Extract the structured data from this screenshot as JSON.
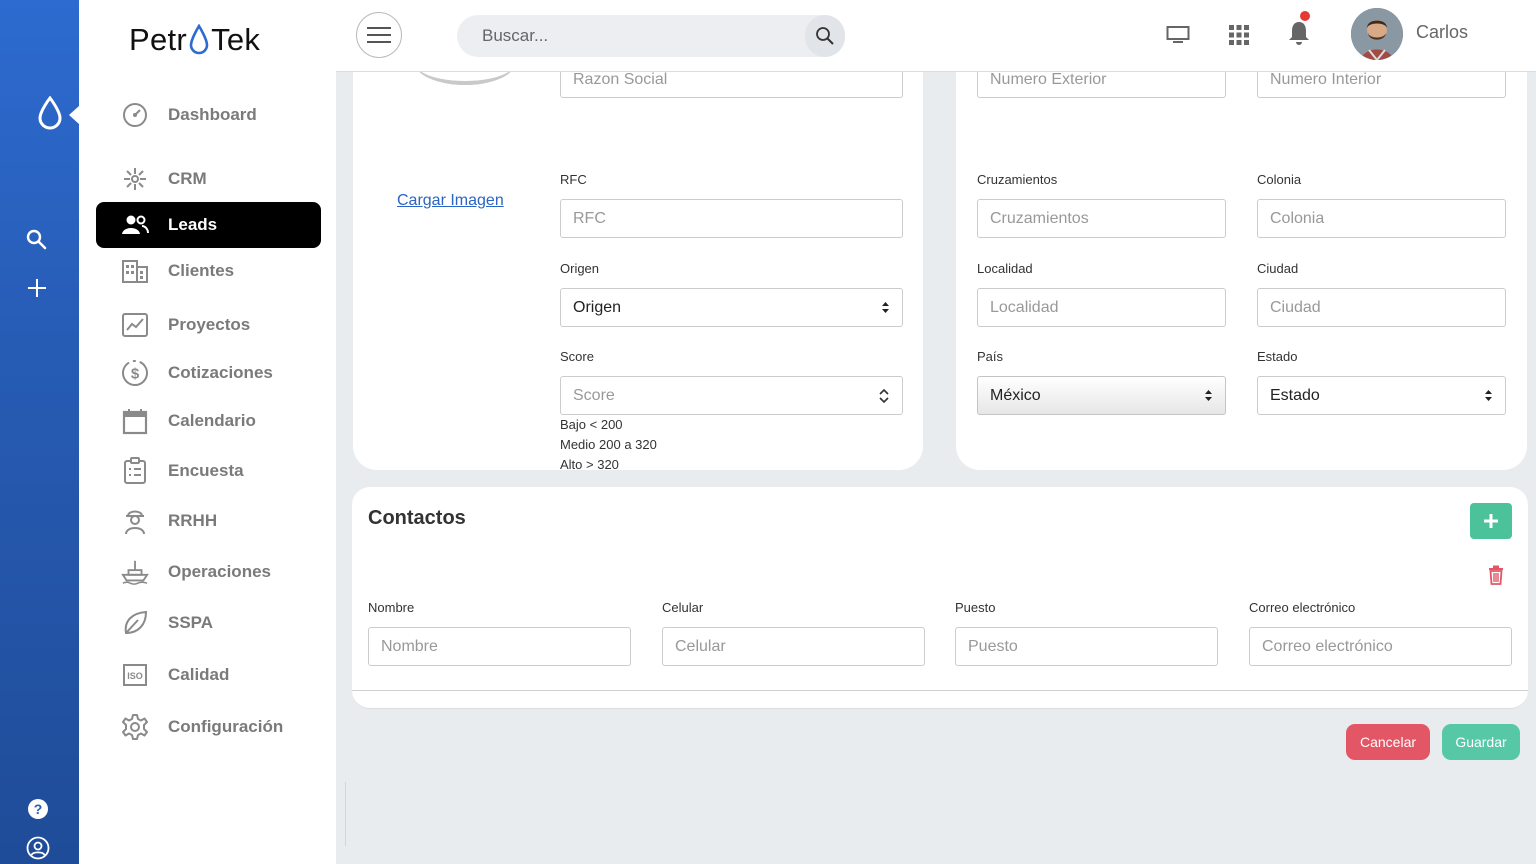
{
  "app": {
    "logo_left": "Petr",
    "logo_right": "Tek",
    "brand_color": "#2d6bd0"
  },
  "sidebar": {
    "items": [
      {
        "label": "Dashboard",
        "icon": "gauge-icon"
      },
      {
        "label": "CRM",
        "icon": "network-icon"
      },
      {
        "label": "Leads",
        "icon": "users-icon",
        "active": true
      },
      {
        "label": "Clientes",
        "icon": "building-icon"
      },
      {
        "label": "Proyectos",
        "icon": "chart-icon"
      },
      {
        "label": "Cotizaciones",
        "icon": "dollar-icon"
      },
      {
        "label": "Calendario",
        "icon": "calendar-icon"
      },
      {
        "label": "Encuesta",
        "icon": "clipboard-icon"
      },
      {
        "label": "RRHH",
        "icon": "worker-icon"
      },
      {
        "label": "Operaciones",
        "icon": "ship-icon"
      },
      {
        "label": "SSPA",
        "icon": "leaf-icon"
      },
      {
        "label": "Calidad",
        "icon": "iso-icon"
      },
      {
        "label": "Configuración",
        "icon": "gear-icon"
      }
    ]
  },
  "topbar": {
    "search_placeholder": "Buscar...",
    "user_name": "Carlos"
  },
  "form_left": {
    "upload_link": "Cargar Imagen",
    "razon_social_placeholder": "Razon Social",
    "rfc_label": "RFC",
    "rfc_placeholder": "RFC",
    "origen_label": "Origen",
    "origen_value": "Origen",
    "score_label": "Score",
    "score_placeholder": "Score",
    "score_hints": [
      "Bajo < 200",
      "Medio 200 a 320",
      "Alto > 320"
    ]
  },
  "form_right": {
    "num_ext_placeholder": "Numero Exterior",
    "num_int_placeholder": "Numero Interior",
    "cruzamientos_label": "Cruzamientos",
    "cruzamientos_placeholder": "Cruzamientos",
    "colonia_label": "Colonia",
    "colonia_placeholder": "Colonia",
    "localidad_label": "Localidad",
    "localidad_placeholder": "Localidad",
    "ciudad_label": "Ciudad",
    "ciudad_placeholder": "Ciudad",
    "pais_label": "País",
    "pais_value": "México",
    "estado_label": "Estado",
    "estado_value": "Estado"
  },
  "contactos": {
    "title": "Contactos",
    "nombre_label": "Nombre",
    "nombre_placeholder": "Nombre",
    "celular_label": "Celular",
    "celular_placeholder": "Celular",
    "puesto_label": "Puesto",
    "puesto_placeholder": "Puesto",
    "correo_label": "Correo electrónico",
    "correo_placeholder": "Correo electrónico"
  },
  "actions": {
    "cancel_label": "Cancelar",
    "save_label": "Guardar"
  },
  "colors": {
    "cancel": "#e35665",
    "save": "#56c8a6",
    "add": "#4cc29b",
    "link": "#2a64c4"
  }
}
